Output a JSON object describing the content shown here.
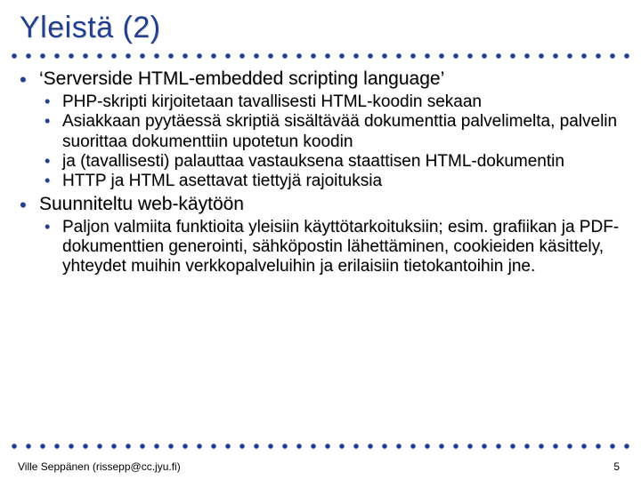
{
  "title": "Yleistä (2)",
  "bullets": {
    "b1": "‘Serverside HTML-embedded scripting language’",
    "b1_subs": {
      "s1": "PHP-skripti kirjoitetaan tavallisesti HTML-koodin sekaan",
      "s2": "Asiakkaan pyytäessä skriptiä sisältävää dokumenttia palvelimelta, palvelin suorittaa dokumenttiin upotetun koodin",
      "s3": "ja (tavallisesti) palauttaa vastauksena staattisen HTML-dokumentin",
      "s4": "HTTP ja HTML asettavat tiettyjä rajoituksia"
    },
    "b2": "Suunniteltu web-käytöön",
    "b2_subs": {
      "s1": "Paljon valmiita funktioita yleisiin käyttötarkoituksiin; esim. grafiikan ja PDF-dokumenttien generointi, sähköpostin lähettäminen, cookieiden käsittely, yhteydet muihin verkkopalveluihin ja erilaisiin tietokantoihin jne."
    }
  },
  "footer": {
    "author": "Ville Seppänen (rissepp@cc.jyu.fi)",
    "page": "5"
  }
}
